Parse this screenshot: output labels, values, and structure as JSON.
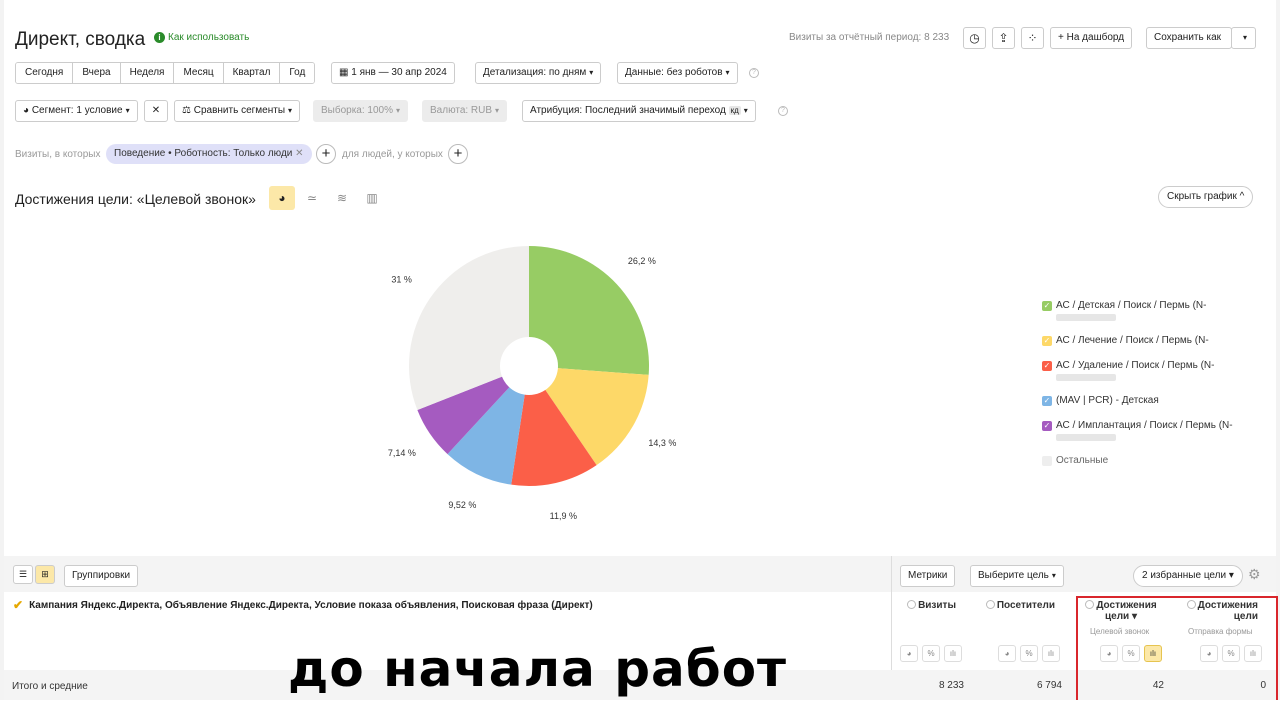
{
  "header": {
    "title": "Директ, сводка",
    "howto": "Как использовать",
    "visits_total": "Визиты за отчётный период: 8 233",
    "to_dashboard": "На дашборд",
    "save_as": "Сохранить как"
  },
  "periods": [
    "Сегодня",
    "Вчера",
    "Неделя",
    "Месяц",
    "Квартал",
    "Год"
  ],
  "date_range": "1 янв — 30 апр 2024",
  "detail": "Детализация: по дням",
  "data_filter": "Данные: без роботов",
  "filters": {
    "segment": "Сегмент: 1 условие",
    "compare": "Сравнить сегменты",
    "sample": "Выборка: 100%",
    "currency": "Валюта: RUB",
    "attribution": "Атрибуция: Последний значимый переход",
    "attribution_badge": "кд"
  },
  "condition": {
    "visits_where": "Визиты, в которых",
    "chip": "Поведение • Роботность: Только люди",
    "people_where": "для людей, у которых"
  },
  "chart_header": {
    "title": "Достижения цели: «Целевой звонок»",
    "hide_graph": "Скрыть график"
  },
  "chart_data": {
    "type": "pie",
    "donut": true,
    "slices": [
      {
        "label": "АС / Детская / Поиск / Пермь (N-",
        "value": 26.2,
        "display": "26,2 %",
        "color": "#97cc64"
      },
      {
        "label": "АС / Лечение / Поиск / Пермь (N-",
        "value": 14.3,
        "display": "14,3 %",
        "color": "#fdd868"
      },
      {
        "label": "АС / Удаление / Поиск / Пермь (N-",
        "value": 11.9,
        "display": "11,9 %",
        "color": "#fb5f48"
      },
      {
        "label": "(MAV | PCR) - Детская",
        "value": 9.52,
        "display": "9,52 %",
        "color": "#7eb5e5"
      },
      {
        "label": "АС / Имплантация / Поиск / Пермь (N-",
        "value": 7.14,
        "display": "7,14 %",
        "color": "#a55bc0"
      },
      {
        "label": "Остальные",
        "value": 31,
        "display": "31 %",
        "color": "#efeeec"
      }
    ]
  },
  "table": {
    "groupings": "Группировки",
    "metrics": "Метрики",
    "choose_goal": "Выберите цель",
    "fav_goals": "2 избранные цели",
    "dimensions": "Кампания Яндекс.Директа, Объявление Яндекс.Директа, Условие показа объявления, Поисковая фраза (Директ)",
    "columns": [
      {
        "name": "Визиты",
        "sub": ""
      },
      {
        "name": "Посетители",
        "sub": ""
      },
      {
        "name": "Достижения цели",
        "sub": "Целевой звонок"
      },
      {
        "name": "Достижения цели",
        "sub": "Отправка формы"
      }
    ],
    "total_label": "Итого и средние",
    "totals": [
      "8 233",
      "6 794",
      "42",
      "0"
    ]
  },
  "caption": "до начала работ"
}
